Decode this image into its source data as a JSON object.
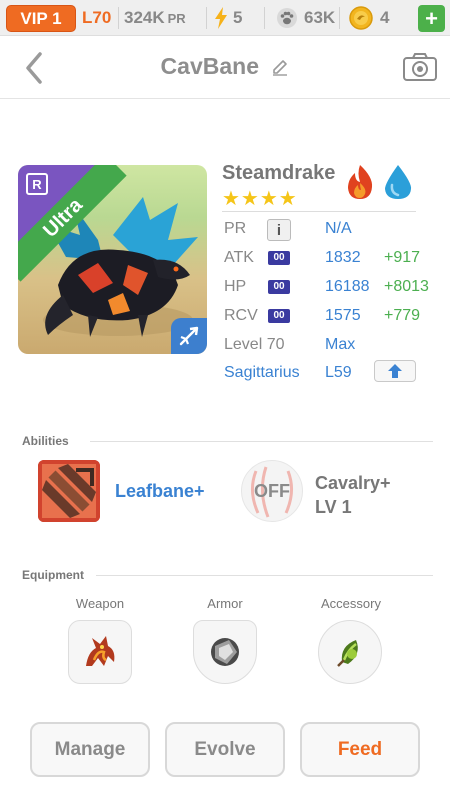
{
  "status_bar": {
    "vip": "VIP 1",
    "level": "L70",
    "pr_value": "324K",
    "pr_unit": "PR",
    "energy": "5",
    "paw_value": "63K",
    "coin_value": "4",
    "plus_label": "+"
  },
  "header": {
    "title": "CavBane"
  },
  "monster": {
    "name": "Steamdrake",
    "stars": "★★★★",
    "rarity": "Ultra",
    "rarity_icon_letter": "R",
    "elements": [
      "fire",
      "water"
    ],
    "stats": {
      "pr_label": "PR",
      "pr_value": "N/A",
      "info_label": "i",
      "atk_label": "ATK",
      "atk_value": "1832",
      "atk_bonus": "+917",
      "hp_label": "HP",
      "hp_value": "16188",
      "hp_bonus": "+8013",
      "rcv_label": "RCV",
      "rcv_value": "1575",
      "rcv_bonus": "+779",
      "badge": "00",
      "level_label": "Level 70",
      "level_value": "Max"
    },
    "constellation": "Sagittarius",
    "constellation_level": "L59"
  },
  "abilities": {
    "title": "Abilities",
    "items": [
      {
        "name": "Leafbane+"
      },
      {
        "state": "OFF",
        "name": "Cavalry+",
        "level": "LV 1"
      }
    ]
  },
  "equipment": {
    "title": "Equipment",
    "slots": [
      {
        "label": "Weapon"
      },
      {
        "label": "Armor"
      },
      {
        "label": "Accessory"
      }
    ]
  },
  "actions": {
    "manage": "Manage",
    "evolve": "Evolve",
    "feed": "Feed"
  },
  "colors": {
    "accent": "#ef6b22",
    "link": "#3a82d2",
    "bonus": "#4caf50",
    "ultra": "#44a84c"
  }
}
